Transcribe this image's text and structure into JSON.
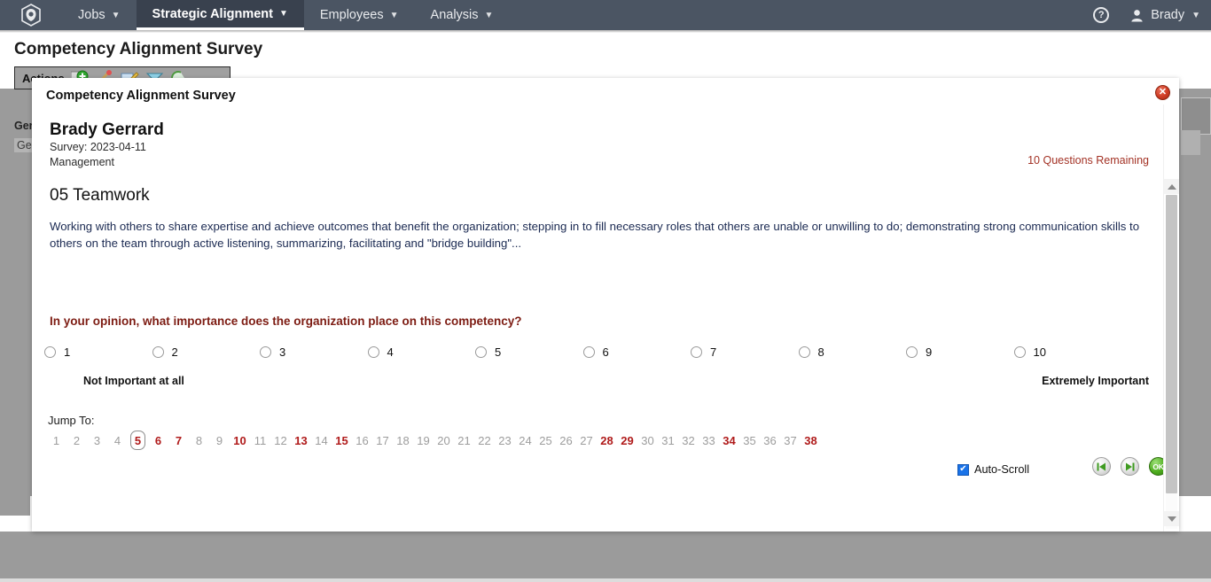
{
  "nav": {
    "logo_icon": "cube-logo-icon",
    "items": [
      {
        "label": "Jobs",
        "active": false
      },
      {
        "label": "Strategic Alignment",
        "active": true
      },
      {
        "label": "Employees",
        "active": false
      },
      {
        "label": "Analysis",
        "active": false
      }
    ],
    "help_label": "?",
    "user_label": "Brady"
  },
  "page": {
    "title": "Competency Alignment Survey",
    "toolbar_label": "Actions",
    "behind_label_1": "Ger",
    "behind_label_2": "Ger"
  },
  "modal": {
    "title": "Competency Alignment Survey",
    "close_label": "✕",
    "person_name": "Brady Gerrard",
    "survey_date": "Survey: 2023-04-11",
    "survey_group": "Management",
    "questions_remaining": "10 Questions Remaining",
    "competency_title": "05 Teamwork",
    "competency_description": "Working with others to share expertise and achieve outcomes that benefit the organization; stepping in to fill necessary roles that others are unable or unwilling to do; demonstrating strong communication skills to others on the team through active listening, summarizing, facilitating and \"bridge building\"...",
    "question_prompt": "In your opinion, what importance does the organization place on this competency?",
    "scale": {
      "options": [
        "1",
        "2",
        "3",
        "4",
        "5",
        "6",
        "7",
        "8",
        "9",
        "10"
      ],
      "selected": null,
      "anchor_low": "Not Important at all",
      "anchor_high": "Extremely Important"
    },
    "jump": {
      "label": "Jump To:",
      "current": 5,
      "answered": [
        6,
        7,
        10,
        13,
        15,
        28,
        29,
        34,
        38
      ],
      "numbers": [
        1,
        2,
        3,
        4,
        5,
        6,
        7,
        8,
        9,
        10,
        11,
        12,
        13,
        14,
        15,
        16,
        17,
        18,
        19,
        20,
        21,
        22,
        23,
        24,
        25,
        26,
        27,
        28,
        29,
        30,
        31,
        32,
        33,
        34,
        35,
        36,
        37,
        38
      ]
    },
    "footer": {
      "autoscroll_label": "Auto-Scroll",
      "autoscroll_checked": true,
      "autoscroll_check_glyph": "✔",
      "prev_icon": "skip-previous-icon",
      "next_icon": "skip-next-icon",
      "ok_icon": "ok-button-icon",
      "ok_label": "OK"
    }
  },
  "colors": {
    "navbar": "#4b5563",
    "accent_red": "#b01b1b",
    "prompt_red": "#7d1c13",
    "remaining_red": "#a33225",
    "jump_grey": "#9d9d9d",
    "page_grey": "#9b9b9b",
    "ok_green": "#4fae1f"
  }
}
